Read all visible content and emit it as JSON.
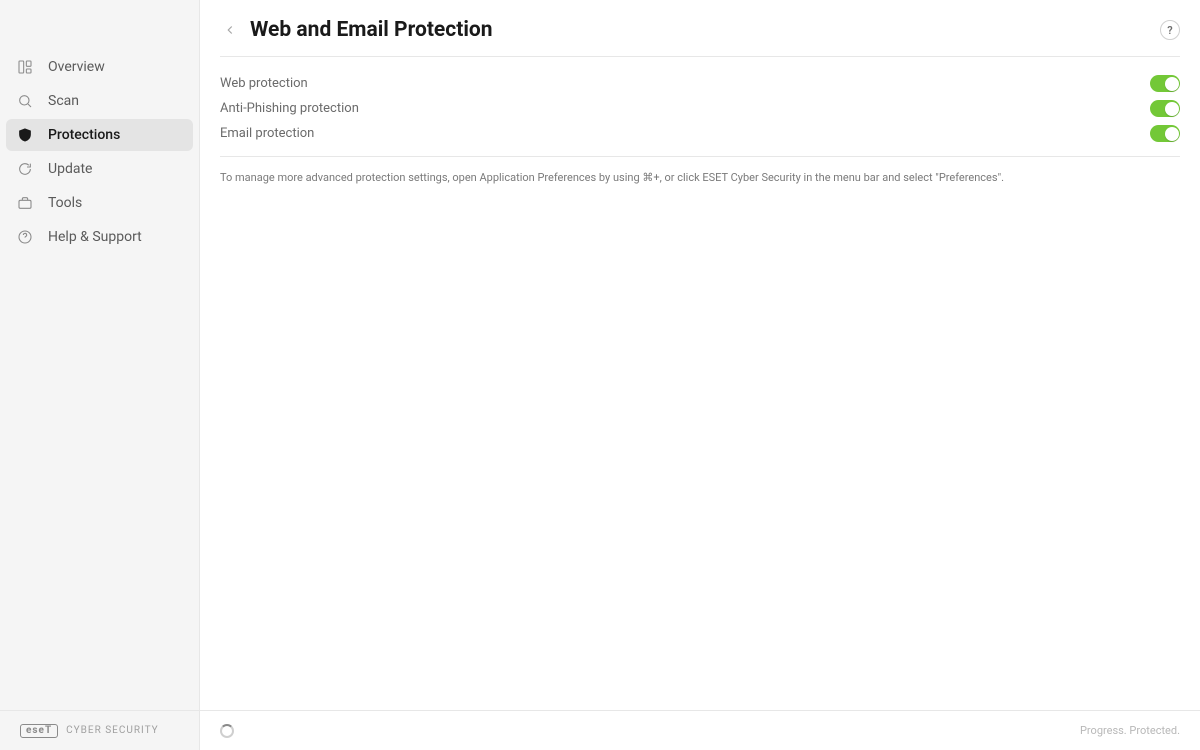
{
  "sidebar": {
    "items": [
      {
        "label": "Overview",
        "icon": "overview"
      },
      {
        "label": "Scan",
        "icon": "scan"
      },
      {
        "label": "Protections",
        "icon": "shield",
        "active": true
      },
      {
        "label": "Update",
        "icon": "update"
      },
      {
        "label": "Tools",
        "icon": "tools"
      },
      {
        "label": "Help & Support",
        "icon": "help"
      }
    ]
  },
  "page": {
    "title": "Web and Email Protection",
    "help_symbol": "?"
  },
  "settings": [
    {
      "label": "Web protection",
      "on": true
    },
    {
      "label": "Anti-Phishing protection",
      "on": true
    },
    {
      "label": "Email protection",
      "on": true
    }
  ],
  "info_text": "To manage more advanced protection settings, open Application Preferences by using ⌘+, or click ESET Cyber Security in the menu bar and select \"Preferences\".",
  "footer": {
    "brand_logo": "eseT",
    "brand_name": "CYBER SECURITY",
    "tagline": "Progress. Protected."
  }
}
